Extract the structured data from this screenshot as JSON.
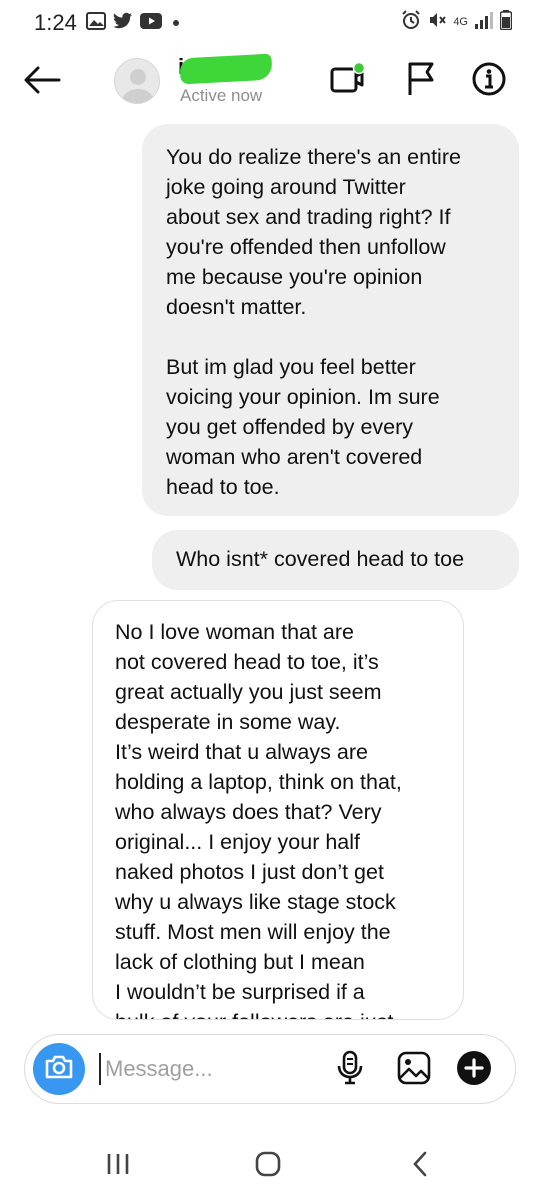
{
  "status_bar": {
    "time": "1:24",
    "network_label": "4G"
  },
  "header": {
    "contact_name": "i",
    "active_status": "Active now"
  },
  "messages": [
    {
      "sender": "me",
      "text": "You do realize there's an entire\njoke going around Twitter\nabout sex and trading right? If\nyou're offended then unfollow\nme because you're opinion\ndoesn't matter.\n\nBut im glad you feel better\nvoicing your opinion. Im sure\nyou get offended by every\nwoman who aren't covered\nhead to toe."
    },
    {
      "sender": "me",
      "text": "Who isnt* covered head to toe"
    },
    {
      "sender": "them",
      "text": "No I love woman that are\nnot covered head to toe, it’s\ngreat actually you just seem\ndesperate in some way.\nIt’s weird that u always are\nholding a laptop, think on that,\nwho always does that? Very\noriginal... I enjoy your half\nnaked photos I just don’t get\nwhy u always like stage stock\nstuff. Most men will enjoy the\nlack of clothing but I mean\nI wouldn’t be surprised if a\nbulk of your followers are just"
    }
  ],
  "composer": {
    "placeholder": "Message..."
  },
  "colors": {
    "accent_blue": "#3897f0",
    "online_green": "#3ec93a",
    "sent_bubble": "#efefef"
  },
  "icons": {
    "back": "arrow-left-icon",
    "video": "video-call-icon",
    "flag": "flag-icon",
    "info": "info-icon",
    "camera": "camera-icon",
    "mic": "microphone-icon",
    "gallery": "gallery-icon",
    "add": "plus-circle-icon"
  }
}
